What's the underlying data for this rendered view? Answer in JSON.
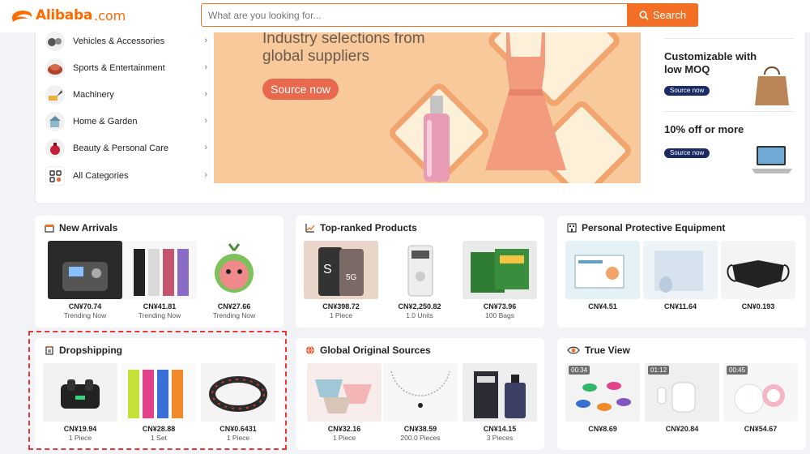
{
  "header": {
    "logo_text": "Alibaba",
    "logo_domain": ".com",
    "search_placeholder": "What are you looking for...",
    "search_button": "Search"
  },
  "categories": [
    {
      "label": "Vehicles & Accessories",
      "icon": "car-icon"
    },
    {
      "label": "Sports & Entertainment",
      "icon": "sports-icon"
    },
    {
      "label": "Machinery",
      "icon": "machinery-icon"
    },
    {
      "label": "Home & Garden",
      "icon": "home-icon"
    },
    {
      "label": "Beauty & Personal Care",
      "icon": "beauty-icon"
    },
    {
      "label": "All Categories",
      "icon": "grid-icon"
    }
  ],
  "banner": {
    "headline": "Industry selections from global suppliers",
    "button": "Source now",
    "dots": 7,
    "active_dot": 3
  },
  "promos": [
    {
      "title": "Customizable with low MOQ",
      "button": "Source now"
    },
    {
      "title": "10% off or more",
      "button": "Source now"
    }
  ],
  "cards": [
    {
      "title": "New Arrivals",
      "items": [
        {
          "price": "CN¥70.74",
          "sub": "Trending Now"
        },
        {
          "price": "CN¥41.81",
          "sub": "Trending Now"
        },
        {
          "price": "CN¥27.66",
          "sub": "Trending Now"
        }
      ]
    },
    {
      "title": "Top-ranked Products",
      "items": [
        {
          "price": "CN¥398.72",
          "sub": "1 Piece"
        },
        {
          "price": "CN¥2,250.82",
          "sub": "1.0 Units"
        },
        {
          "price": "CN¥73.96",
          "sub": "100 Bags"
        }
      ]
    },
    {
      "title": "Personal Protective Equipment",
      "items": [
        {
          "price": "CN¥4.51",
          "sub": ""
        },
        {
          "price": "CN¥11.64",
          "sub": ""
        },
        {
          "price": "CN¥0.193",
          "sub": ""
        }
      ]
    },
    {
      "title": "Dropshipping",
      "items": [
        {
          "price": "CN¥19.94",
          "sub": "1 Piece"
        },
        {
          "price": "CN¥28.88",
          "sub": "1 Set"
        },
        {
          "price": "CN¥0.6431",
          "sub": "1 Piece"
        }
      ]
    },
    {
      "title": "Global Original Sources",
      "items": [
        {
          "price": "CN¥32.16",
          "sub": "1 Piece"
        },
        {
          "price": "CN¥38.59",
          "sub": "200.0 Pieces"
        },
        {
          "price": "CN¥14.15",
          "sub": "3 Pieces"
        }
      ]
    },
    {
      "title": "True View",
      "items": [
        {
          "price": "CN¥8.69",
          "sub": "",
          "video": "00:34"
        },
        {
          "price": "CN¥20.84",
          "sub": "",
          "video": "01:12"
        },
        {
          "price": "CN¥54.67",
          "sub": "",
          "video": "00:45"
        }
      ]
    }
  ],
  "colors": {
    "brand": "#ff6a00",
    "search_button": "#f36f25",
    "promo_button": "#1b2b63",
    "highlight": "#e53935"
  }
}
